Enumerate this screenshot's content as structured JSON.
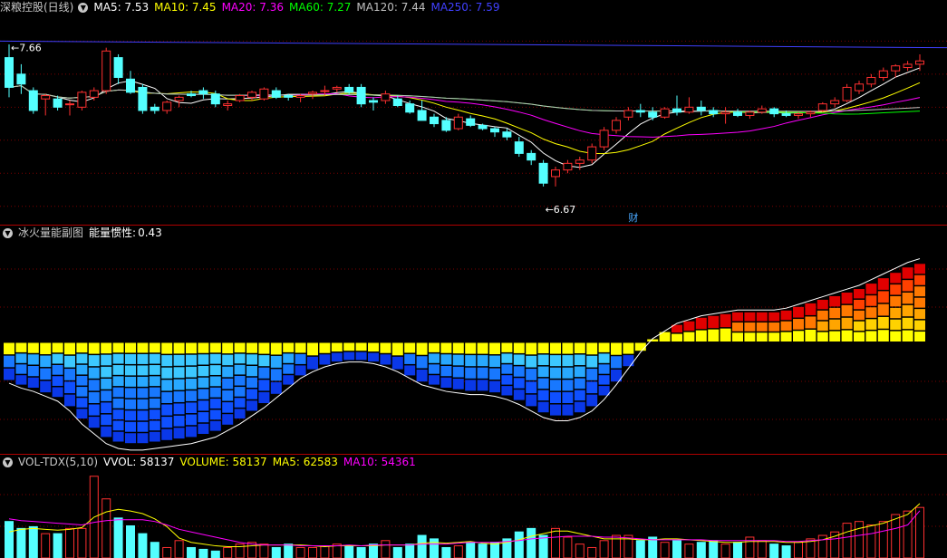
{
  "main": {
    "title": "深粮控股(日线)",
    "indicators": [
      {
        "label": "MA5: 7.53",
        "color": "#ffffff"
      },
      {
        "label": "MA10: 7.45",
        "color": "#ffff00"
      },
      {
        "label": "MA20: 7.36",
        "color": "#ff00ff"
      },
      {
        "label": "MA60: 7.27",
        "color": "#00ff00"
      },
      {
        "label": "MA120: 7.44",
        "color": "#c0c0c0"
      },
      {
        "label": "MA250: 7.59",
        "color": "#4040ff"
      }
    ],
    "high_label": "7.66",
    "low_label": "6.67",
    "marker_label": "财"
  },
  "energy": {
    "title": "冰火量能副图",
    "inertia_label": "能量惯性",
    "inertia_value": "0.43"
  },
  "vol": {
    "title": "VOL-TDX(5,10)",
    "indicators": [
      {
        "label": "VVOL: 58137",
        "color": "#ffffff"
      },
      {
        "label": "VOLUME: 58137",
        "color": "#ffff00"
      },
      {
        "label": "MA5: 62583",
        "color": "#ffff00"
      },
      {
        "label": "MA10: 54361",
        "color": "#ff00ff"
      }
    ]
  },
  "colors": {
    "up": "#ff3030",
    "down": "#54ffff",
    "grid": "#7a0000"
  },
  "chart_data": [
    {
      "type": "candlestick",
      "title": "深粮控股(日线)",
      "ohlc": [
        [
          7.6,
          7.68,
          7.36,
          7.42
        ],
        [
          7.5,
          7.56,
          7.38,
          7.44
        ],
        [
          7.4,
          7.42,
          7.26,
          7.28
        ],
        [
          7.35,
          7.38,
          7.25,
          7.37
        ],
        [
          7.35,
          7.37,
          7.28,
          7.3
        ],
        [
          7.32,
          7.34,
          7.25,
          7.32
        ],
        [
          7.3,
          7.4,
          7.28,
          7.39
        ],
        [
          7.36,
          7.42,
          7.34,
          7.4
        ],
        [
          7.4,
          7.66,
          7.38,
          7.64
        ],
        [
          7.6,
          7.62,
          7.44,
          7.48
        ],
        [
          7.47,
          7.52,
          7.38,
          7.39
        ],
        [
          7.42,
          7.44,
          7.26,
          7.28
        ],
        [
          7.3,
          7.32,
          7.26,
          7.28
        ],
        [
          7.28,
          7.34,
          7.26,
          7.33
        ],
        [
          7.34,
          7.37,
          7.3,
          7.36
        ],
        [
          7.38,
          7.4,
          7.36,
          7.37
        ],
        [
          7.4,
          7.42,
          7.35,
          7.38
        ],
        [
          7.38,
          7.4,
          7.3,
          7.32
        ],
        [
          7.31,
          7.34,
          7.28,
          7.32
        ],
        [
          7.34,
          7.38,
          7.33,
          7.37
        ],
        [
          7.36,
          7.4,
          7.34,
          7.39
        ],
        [
          7.35,
          7.42,
          7.34,
          7.41
        ],
        [
          7.4,
          7.42,
          7.35,
          7.36
        ],
        [
          7.37,
          7.38,
          7.34,
          7.36
        ],
        [
          7.36,
          7.38,
          7.33,
          7.37
        ],
        [
          7.38,
          7.4,
          7.35,
          7.39
        ],
        [
          7.4,
          7.43,
          7.37,
          7.4
        ],
        [
          7.41,
          7.43,
          7.39,
          7.42
        ],
        [
          7.42,
          7.44,
          7.38,
          7.39
        ],
        [
          7.42,
          7.44,
          7.3,
          7.32
        ],
        [
          7.34,
          7.36,
          7.28,
          7.33
        ],
        [
          7.34,
          7.4,
          7.32,
          7.38
        ],
        [
          7.35,
          7.37,
          7.3,
          7.31
        ],
        [
          7.32,
          7.34,
          7.26,
          7.27
        ],
        [
          7.28,
          7.34,
          7.24,
          7.22
        ],
        [
          7.24,
          7.26,
          7.18,
          7.2
        ],
        [
          7.22,
          7.24,
          7.15,
          7.16
        ],
        [
          7.17,
          7.26,
          7.16,
          7.24
        ],
        [
          7.23,
          7.25,
          7.18,
          7.19
        ],
        [
          7.19,
          7.2,
          7.16,
          7.17
        ],
        [
          7.17,
          7.18,
          7.12,
          7.15
        ],
        [
          7.15,
          7.17,
          7.1,
          7.12
        ],
        [
          7.09,
          7.12,
          7.0,
          7.02
        ],
        [
          7.02,
          7.04,
          6.95,
          6.98
        ],
        [
          6.96,
          6.98,
          6.82,
          6.84
        ],
        [
          6.88,
          6.94,
          6.82,
          6.92
        ],
        [
          6.92,
          6.98,
          6.9,
          6.96
        ],
        [
          6.96,
          7.0,
          6.92,
          6.98
        ],
        [
          6.98,
          7.08,
          6.96,
          7.06
        ],
        [
          7.06,
          7.18,
          7.04,
          7.16
        ],
        [
          7.16,
          7.24,
          7.14,
          7.22
        ],
        [
          7.24,
          7.3,
          7.22,
          7.28
        ],
        [
          7.28,
          7.32,
          7.24,
          7.27
        ],
        [
          7.27,
          7.3,
          7.22,
          7.24
        ],
        [
          7.24,
          7.3,
          7.23,
          7.29
        ],
        [
          7.29,
          7.37,
          7.25,
          7.27
        ],
        [
          7.27,
          7.36,
          7.26,
          7.3
        ],
        [
          7.3,
          7.34,
          7.25,
          7.28
        ],
        [
          7.28,
          7.3,
          7.24,
          7.26
        ],
        [
          7.26,
          7.3,
          7.2,
          7.27
        ],
        [
          7.27,
          7.29,
          7.24,
          7.25
        ],
        [
          7.25,
          7.28,
          7.23,
          7.27
        ],
        [
          7.27,
          7.31,
          7.26,
          7.29
        ],
        [
          7.29,
          7.3,
          7.24,
          7.26
        ],
        [
          7.26,
          7.28,
          7.24,
          7.25
        ],
        [
          7.25,
          7.27,
          7.23,
          7.26
        ],
        [
          7.26,
          7.28,
          7.24,
          7.27
        ],
        [
          7.28,
          7.33,
          7.27,
          7.32
        ],
        [
          7.32,
          7.36,
          7.3,
          7.34
        ],
        [
          7.34,
          7.44,
          7.33,
          7.42
        ],
        [
          7.4,
          7.46,
          7.38,
          7.44
        ],
        [
          7.44,
          7.5,
          7.42,
          7.48
        ],
        [
          7.48,
          7.54,
          7.46,
          7.52
        ],
        [
          7.52,
          7.56,
          7.48,
          7.55
        ],
        [
          7.54,
          7.58,
          7.52,
          7.56
        ],
        [
          7.56,
          7.62,
          7.52,
          7.58
        ]
      ],
      "ma_lines": [
        "MA5",
        "MA10",
        "MA20",
        "MA60",
        "MA120",
        "MA250"
      ],
      "ylim": [
        6.6,
        7.85
      ],
      "high": 7.66,
      "low": 6.67
    },
    {
      "type": "stacked-bar",
      "title": "冰火量能副图",
      "values": [
        -0.25,
        -0.28,
        -0.3,
        -0.33,
        -0.36,
        -0.42,
        -0.5,
        -0.56,
        -0.62,
        -0.65,
        -0.66,
        -0.66,
        -0.65,
        -0.64,
        -0.63,
        -0.62,
        -0.6,
        -0.58,
        -0.54,
        -0.5,
        -0.45,
        -0.4,
        -0.34,
        -0.28,
        -0.22,
        -0.18,
        -0.15,
        -0.13,
        -0.12,
        -0.12,
        -0.13,
        -0.15,
        -0.18,
        -0.22,
        -0.26,
        -0.28,
        -0.3,
        -0.31,
        -0.32,
        -0.32,
        -0.33,
        -0.35,
        -0.38,
        -0.42,
        -0.46,
        -0.48,
        -0.48,
        -0.46,
        -0.42,
        -0.35,
        -0.26,
        -0.16,
        -0.06,
        0.02,
        0.06,
        0.1,
        0.12,
        0.14,
        0.15,
        0.16,
        0.17,
        0.17,
        0.17,
        0.17,
        0.18,
        0.2,
        0.22,
        0.24,
        0.26,
        0.28,
        0.3,
        0.33,
        0.36,
        0.39,
        0.42,
        0.44
      ],
      "ylim": [
        -0.7,
        0.55
      ]
    },
    {
      "type": "bar",
      "title": "VOL-TDX(5,10)",
      "values": [
        42000,
        34000,
        36000,
        28000,
        28000,
        34000,
        34000,
        94000,
        68000,
        46000,
        37000,
        28000,
        18000,
        12000,
        20000,
        12000,
        10000,
        8000,
        12000,
        16000,
        18000,
        16000,
        12000,
        16000,
        12000,
        12000,
        14000,
        16000,
        14000,
        12000,
        16000,
        20000,
        12000,
        16000,
        26000,
        22000,
        12000,
        14000,
        18000,
        16000,
        18000,
        22000,
        30000,
        34000,
        26000,
        34000,
        24000,
        16000,
        12000,
        20000,
        26000,
        26000,
        20000,
        24000,
        18000,
        20000,
        16000,
        18000,
        20000,
        16000,
        18000,
        24000,
        20000,
        16000,
        14000,
        18000,
        22000,
        26000,
        30000,
        40000,
        42000,
        38000,
        42000,
        50000,
        54000,
        58137
      ],
      "ma5": [
        30000,
        33000,
        34000,
        33000,
        32000,
        33000,
        35000,
        47000,
        53000,
        56000,
        54000,
        51000,
        45000,
        36000,
        23000,
        18000,
        16000,
        14000,
        13000,
        13000,
        14000,
        15000,
        15000,
        15000,
        15000,
        14000,
        13000,
        14000,
        14000,
        14000,
        14000,
        15000,
        15000,
        15000,
        17000,
        18000,
        17000,
        18000,
        19000,
        17000,
        16000,
        18000,
        21000,
        25000,
        28000,
        31000,
        31000,
        28000,
        25000,
        22000,
        22000,
        22000,
        21000,
        21000,
        22000,
        22000,
        21000,
        20000,
        19000,
        18000,
        18000,
        19000,
        19000,
        19000,
        18000,
        18000,
        19000,
        21000,
        25000,
        30000,
        34000,
        37000,
        40000,
        45000,
        50000,
        62583
      ],
      "ma10": [
        45000,
        43000,
        42000,
        41000,
        40000,
        39000,
        38000,
        41000,
        43000,
        44000,
        44000,
        44000,
        42000,
        38000,
        33000,
        30000,
        27000,
        24000,
        21000,
        18000,
        16000,
        15000,
        15000,
        15000,
        14000,
        14000,
        14000,
        14000,
        15000,
        14000,
        15000,
        15000,
        15000,
        15000,
        16000,
        16000,
        16000,
        17000,
        18000,
        18000,
        18000,
        19000,
        20000,
        22000,
        23000,
        24000,
        25000,
        25000,
        25000,
        24000,
        24000,
        23000,
        22000,
        21000,
        21000,
        21000,
        21000,
        21000,
        20000,
        20000,
        20000,
        20000,
        20000,
        20000,
        19000,
        19000,
        20000,
        21000,
        22000,
        24000,
        26000,
        28000,
        31000,
        34000,
        38000,
        54361
      ],
      "ylim": [
        0,
        100000
      ]
    }
  ]
}
